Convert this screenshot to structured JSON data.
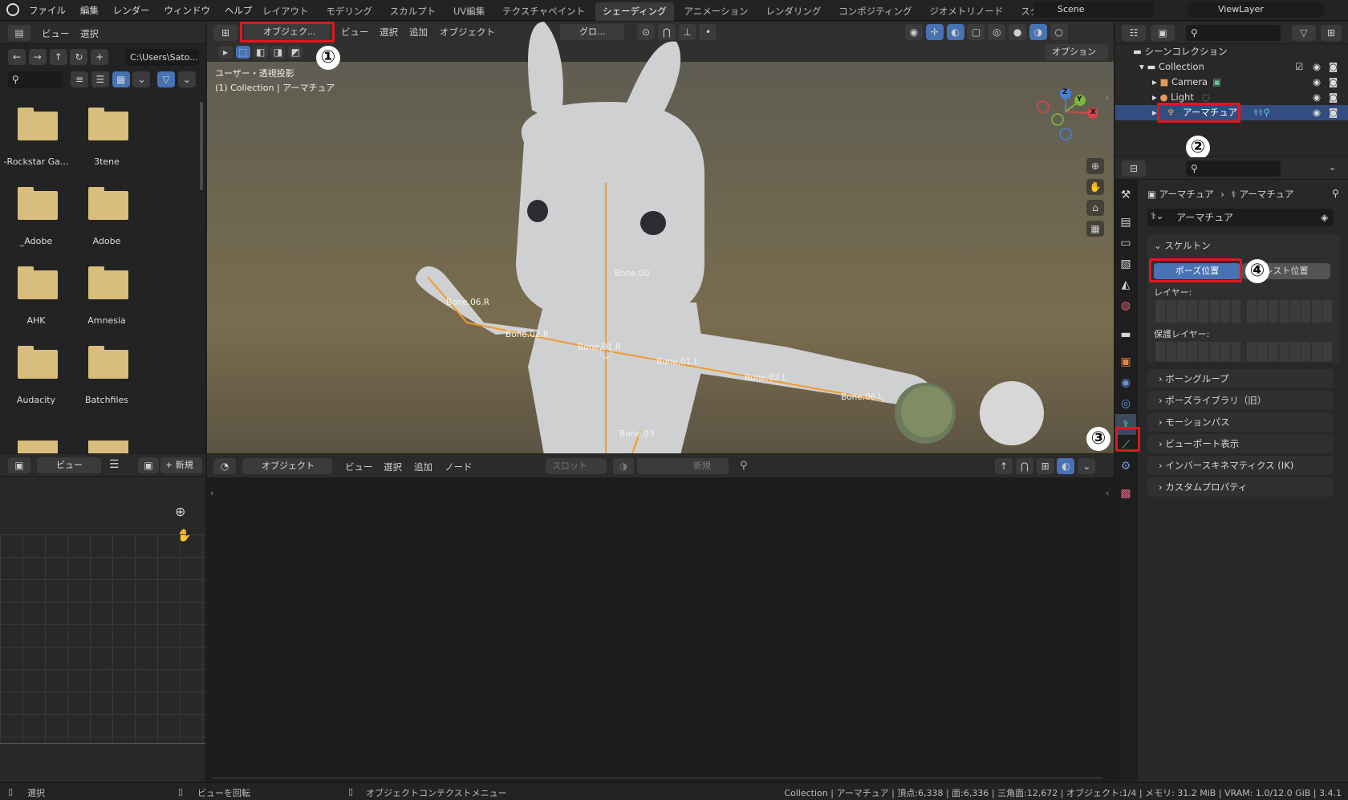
{
  "topbar": {
    "menus": [
      "ファイル",
      "編集",
      "レンダー",
      "ウィンドウ",
      "ヘルプ"
    ],
    "workspaces": [
      "レイアウト",
      "モデリング",
      "スカルプト",
      "UV編集",
      "テクスチャペイント",
      "シェーディング",
      "アニメーション",
      "レンダリング",
      "コンポジティング",
      "ジオメトリノード",
      "スクリプト"
    ],
    "active_workspace": "シェーディング",
    "scene": "Scene",
    "view_layer": "ViewLayer"
  },
  "file_browser": {
    "header": {
      "view": "ビュー",
      "select": "選択"
    },
    "path": "C:\\Users\\Sato...",
    "folders": [
      "-Rockstar Ga...",
      "3tene",
      "_Adobe",
      "Adobe",
      "AHK",
      "Amnesia",
      "Audacity",
      "Batchfiles"
    ]
  },
  "viewport": {
    "mode": "オブジェク...",
    "menus": [
      "ビュー",
      "選択",
      "追加",
      "オブジェクト"
    ],
    "transform": "グロ...",
    "options": "オプション",
    "overlay_line1": "ユーザー・透視投影",
    "overlay_line2": "(1) Collection | アーマチュア",
    "bones": [
      "Bone.00",
      "Bone.06.R",
      "Bone.02.R",
      "Bone.01.R",
      "Bone.01.L",
      "Bone.02.L",
      "Bone.06.L",
      "Bone.03"
    ],
    "gizmo": {
      "x": "X",
      "y": "Y",
      "z": "Z"
    }
  },
  "node_editor": {
    "left_header": {
      "view": "ビュー",
      "new": "新規"
    },
    "mode": "オブジェクト",
    "menus": [
      "ビュー",
      "選択",
      "追加",
      "ノード"
    ],
    "slot": "スロット",
    "new": "新規"
  },
  "outliner": {
    "scene_collection": "シーンコレクション",
    "collection": "Collection",
    "items": [
      "Camera",
      "Light",
      "アーマチュア"
    ],
    "selected": "アーマチュア"
  },
  "properties": {
    "breadcrumb": [
      "アーマチュア",
      "アーマチュア"
    ],
    "data_name": "アーマチュア",
    "skeleton": {
      "title": "スケルトン",
      "pose_position": "ポーズ位置",
      "rest_position": "レスト位置",
      "layers": "レイヤー:",
      "protected_layers": "保護レイヤー:"
    },
    "sections": [
      "ボーングループ",
      "ポーズライブラリ（旧）",
      "モーションパス",
      "ビューポート表示",
      "インバースキネマティクス (IK)",
      "カスタムプロパティ"
    ]
  },
  "annotations": [
    "①",
    "②",
    "③",
    "④"
  ],
  "statusbar": {
    "left": [
      "選択",
      "ビューを回転",
      "オブジェクトコンテクストメニュー"
    ],
    "right": "Collection | アーマチュア | 頂点:6,338 | 面:6,336 | 三角面:12,672 | オブジェクト:1/4 | メモリ: 31.2 MiB | VRAM: 1.0/12.0 GiB | 3.4.1"
  },
  "colors": {
    "accent": "#4772b3",
    "annotation_red": "#e0171e",
    "bone": "#f29b2b",
    "folder": "#d8bd7d"
  }
}
